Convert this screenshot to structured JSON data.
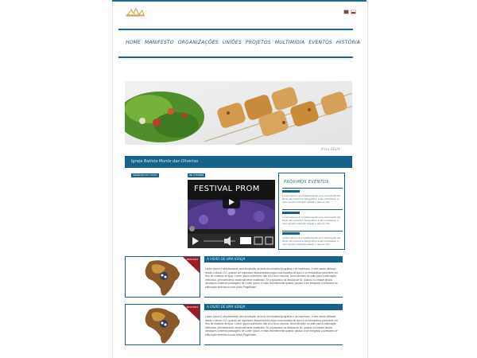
{
  "brand": {
    "logo_text": "IDATO",
    "accent": "#17628a",
    "gold": "#c7a03a"
  },
  "flags": [
    "portuguese-flag",
    "czech-flag"
  ],
  "nav": {
    "items": [
      "HOME",
      "MANIFESTO",
      "ORGANIZAÇÕES",
      "UNIÕES",
      "PROJETOS",
      "MULTIMÍDIA",
      "EVENTOS",
      "HISTÓRIA"
    ]
  },
  "hero": {
    "caption": "Frei Hart"
  },
  "banner": {
    "title": "Igreja Batista Monte das Oliveiras"
  },
  "labels": {
    "left": "SEMENTE DO CULTO",
    "video": "DE O PADRE"
  },
  "video": {
    "title": "FESTIVAL PROM"
  },
  "events": {
    "title": "PRÓXIMOS EVENTOS",
    "items": [
      {
        "text": "Lorem Ipsum é simplesmente uma simulação de texto da indústria tipográfica e de impressos, e vem sendo utilizado desde o século XVI"
      },
      {
        "text": "Lorem Ipsum é simplesmente uma simulação de texto da indústria tipográfica e de impressos, e vem sendo utilizado desde o século XVI"
      },
      {
        "text": "Lorem Ipsum é simplesmente uma simulação de texto da indústria tipográfica e de impressos, e vem sendo utilizado desde o século XVI"
      }
    ]
  },
  "articles": [
    {
      "title": "A VISÃO DE UMA IGREJA",
      "date": "28/11/2013",
      "text": "Lorem Ipsum é simplesmente uma simulação de texto da indústria tipográfica e de impressos, e vem sendo utilizado desde o século XVI, quando um impressor desconhecido pegou uma bandeja de tipos e os embaralhou para fazer um livro de modelos de tipos. Lorem Ipsum sobreviveu não só a cinco séculos, como também ao salto para a editoração eletrônica, permanecendo essencialmente inalterado. Se popularizou na década de 60, quando a Letraset lançou decalques contendo passagens de Lorem Ipsum, e mais recentemente quando passou a ser integrado a softwares de editoração eletrônica como Aldus PageMaker."
    },
    {
      "title": "A VISÃO DE UMA IGREJA",
      "date": "28/11/2013",
      "text": "Lorem Ipsum é simplesmente uma simulação de texto da indústria tipográfica e de impressos, e vem sendo utilizado desde o século XVI, quando um impressor desconhecido pegou uma bandeja de tipos e os embaralhou para fazer um livro de modelos de tipos. Lorem Ipsum sobreviveu não só a cinco séculos, como também ao salto para a editoração eletrônica, permanecendo essencialmente inalterado. Se popularizou na década de 60, quando a Letraset lançou decalques contendo passagens de Lorem Ipsum, e mais recentemente quando passou a ser integrado a softwares de editoração eletrônica como Aldus PageMaker."
    }
  ]
}
